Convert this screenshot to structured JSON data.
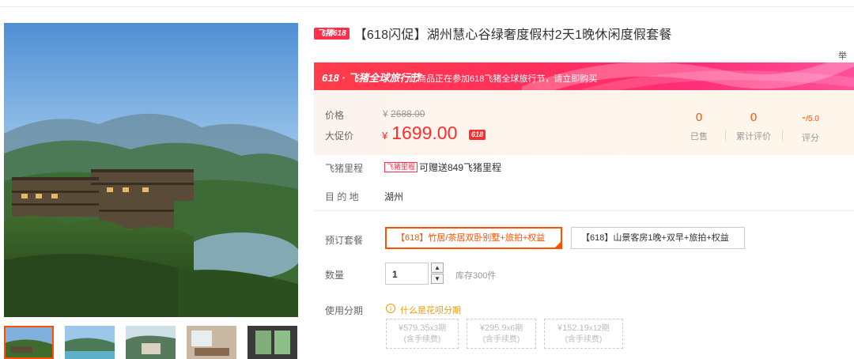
{
  "title": {
    "tag": "飞猪618",
    "text": "【618闪促】湖州慧心谷绿奢度假村2天1晚休闲度假套餐"
  },
  "report_label": "举报",
  "banner": {
    "logo": "618 · 飞猪全球旅行节",
    "text": "此商品正在参加618飞猪全球旅行节，请立即购买"
  },
  "price": {
    "price_label": "价格",
    "original_currency": "¥",
    "original_value": "2688.00",
    "promo_label": "大促价",
    "promo_currency": "¥",
    "promo_value": "1699.00",
    "promo_badge": "618"
  },
  "stats": {
    "sold_value": "0",
    "sold_label": "已售",
    "reviews_value": "0",
    "reviews_label": "累计评价",
    "rating_value": "-",
    "rating_max": "/5.0",
    "rating_label": "评分"
  },
  "mileage": {
    "label": "飞猪里程",
    "tag": "飞猪里程",
    "text": "可赠送849飞猪里程"
  },
  "destination": {
    "label": "目 的 地",
    "value": "湖州"
  },
  "packages": {
    "label": "预订套餐",
    "options": [
      "【618】竹居/茶居双卧别墅+旅拍+权益",
      "【618】山景客房1晚+双早+旅拍+权益"
    ],
    "selected_index": 0
  },
  "quantity": {
    "label": "数量",
    "value": "1",
    "stock": "库存300件"
  },
  "installment": {
    "label": "使用分期",
    "help_icon": "info-icon",
    "link": "什么是花呗分期",
    "plans": [
      {
        "amount": "¥579.35",
        "periods": "x3期",
        "fee": "(含手续费)"
      },
      {
        "amount": "¥295.9",
        "periods": "x6期",
        "fee": "(含手续费)"
      },
      {
        "amount": "¥152.19",
        "periods": "x12期",
        "fee": "(含手续费)"
      }
    ]
  },
  "gallery": {
    "thumbnail_count": 5,
    "selected_thumbnail": 0
  },
  "colors": {
    "accent": "#ff5000",
    "promo_red": "#ff2e2e",
    "banner_pink": "#ff2d77",
    "installment_orange": "#f09a00"
  }
}
